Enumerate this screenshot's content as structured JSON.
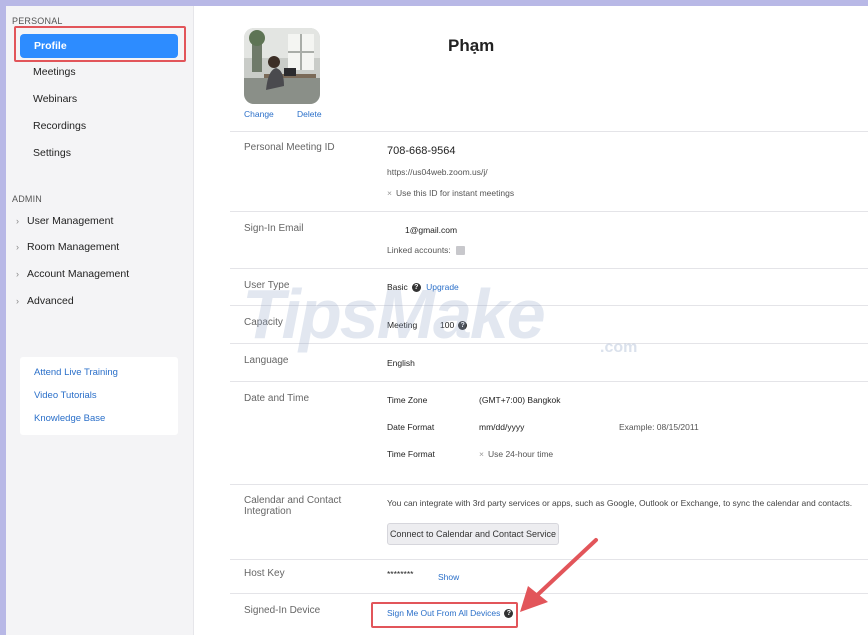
{
  "sidebar": {
    "personal_label": "PERSONAL",
    "personal_items": [
      {
        "label": "Profile",
        "active": true
      },
      {
        "label": "Meetings"
      },
      {
        "label": "Webinars"
      },
      {
        "label": "Recordings"
      },
      {
        "label": "Settings"
      }
    ],
    "admin_label": "ADMIN",
    "admin_items": [
      {
        "label": "User Management"
      },
      {
        "label": "Room Management"
      },
      {
        "label": "Account Management"
      },
      {
        "label": "Advanced"
      }
    ],
    "help_links": [
      {
        "label": "Attend Live Training"
      },
      {
        "label": "Video Tutorials"
      },
      {
        "label": "Knowledge Base"
      }
    ]
  },
  "profile": {
    "name": "Phạm",
    "change_label": "Change",
    "delete_label": "Delete"
  },
  "pmi": {
    "label": "Personal Meeting ID",
    "id": "708-668-9564",
    "url": "https://us04web.zoom.us/j/",
    "instant_option": "Use this ID for instant meetings"
  },
  "signin": {
    "label": "Sign-In Email",
    "email": "1@gmail.com",
    "linked_label": "Linked accounts:"
  },
  "user_type": {
    "label": "User Type",
    "value": "Basic",
    "upgrade": "Upgrade"
  },
  "capacity": {
    "label": "Capacity",
    "meeting_label": "Meeting",
    "meeting_value": "100"
  },
  "language": {
    "label": "Language",
    "value": "English"
  },
  "datetime": {
    "label": "Date and Time",
    "timezone_label": "Time Zone",
    "timezone_value": "(GMT+7:00) Bangkok",
    "dateformat_label": "Date Format",
    "dateformat_value": "mm/dd/yyyy",
    "dateformat_example": "Example: 08/15/2011",
    "timeformat_label": "Time Format",
    "timeformat_value": "Use 24-hour time"
  },
  "calendar": {
    "label_line1": "Calendar and Contact",
    "label_line2": "Integration",
    "description": "You can integrate with 3rd party services or apps, such as Google, Outlook or Exchange, to sync the calendar and contacts.",
    "connect_button": "Connect to Calendar and Contact Service"
  },
  "host_key": {
    "label": "Host Key",
    "value": "********",
    "show": "Show"
  },
  "signed_in": {
    "label": "Signed-In Device",
    "signout": "Sign Me Out From All Devices"
  },
  "watermark": {
    "text": "TipsMake",
    "suffix": ".com"
  },
  "colors": {
    "accent": "#2d8cff",
    "highlight": "#e2555a",
    "link": "#2a6fc9"
  }
}
